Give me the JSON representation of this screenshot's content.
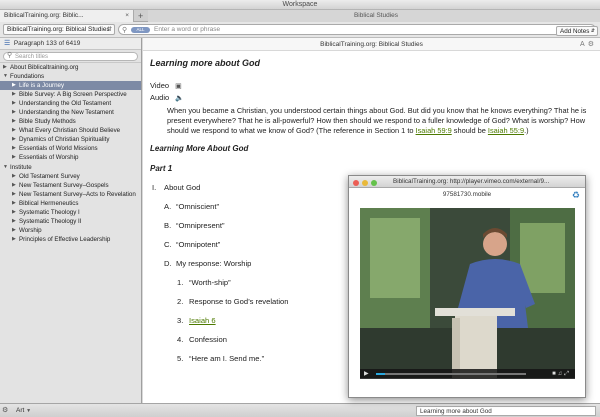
{
  "window": {
    "title": "Workspace"
  },
  "tabs": [
    {
      "label": "BiblicalTraining.org: Biblic...",
      "close": "×"
    },
    {
      "label": "+"
    },
    {
      "label": "Biblical Studies"
    }
  ],
  "toolbar": {
    "resource_select": "BiblicalTraining.org: Biblical Studies",
    "search_pill": "ALL",
    "search_placeholder": "Enter a word or phrase"
  },
  "sidebar": {
    "paragraph_status": "Paragraph 133 of 6419",
    "search_placeholder": "Search titles",
    "items": [
      {
        "label": "About Biblicaltraining.org",
        "level": 0,
        "expanded": false
      },
      {
        "label": "Foundations",
        "level": 0,
        "expanded": true
      },
      {
        "label": "Life is a Journey",
        "level": 1,
        "expanded": false,
        "selected": true
      },
      {
        "label": "Bible Survey: A Big Screen Perspective",
        "level": 1,
        "expanded": false
      },
      {
        "label": "Understanding the Old Testament",
        "level": 1,
        "expanded": false
      },
      {
        "label": "Understanding the New Testament",
        "level": 1,
        "expanded": false
      },
      {
        "label": "Bible Study Methods",
        "level": 1,
        "expanded": false
      },
      {
        "label": "What Every Christian Should Believe",
        "level": 1,
        "expanded": false
      },
      {
        "label": "Dynamics of Christian Spirituality",
        "level": 1,
        "expanded": false
      },
      {
        "label": "Essentials of World Missions",
        "level": 1,
        "expanded": false
      },
      {
        "label": "Essentials of Worship",
        "level": 1,
        "expanded": false
      },
      {
        "label": "Institute",
        "level": 0,
        "expanded": true
      },
      {
        "label": "Old Testament Survey",
        "level": 1,
        "expanded": false
      },
      {
        "label": "New Testament Survey–Gospels",
        "level": 1,
        "expanded": false
      },
      {
        "label": "New Testament Survey–Acts to Revelation",
        "level": 1,
        "expanded": false
      },
      {
        "label": "Biblical Hermeneutics",
        "level": 1,
        "expanded": false
      },
      {
        "label": "Systematic Theology I",
        "level": 1,
        "expanded": false
      },
      {
        "label": "Systematic Theology II",
        "level": 1,
        "expanded": false
      },
      {
        "label": "Worship",
        "level": 1,
        "expanded": false
      },
      {
        "label": "Principles of Effective Leadership",
        "level": 1,
        "expanded": false
      }
    ]
  },
  "reader": {
    "header_title": "BiblicalTraining.org: Biblical Studies",
    "add_notes": "Add Notes",
    "title": "Learning more about God",
    "media_video": "Video",
    "media_audio": "Audio",
    "para_before": "When you became a Christian, you understood certain things about God. But did you know that he knows everything? That he is present everywhere? That he is all-powerful? How then should we respond to a fuller knowledge of God? What is worship? How should we respond to what we know of God? (The reference in Section 1 to ",
    "para_link1": "Isaiah 59:9",
    "para_mid": " should be ",
    "para_link2": "Isaiah 55:9",
    "para_after": ".)",
    "subheading": "Learning More About God",
    "part": "Part 1",
    "outline": {
      "i_num": "I.",
      "i_label": "About God",
      "a_num": "A.",
      "a_label": "“Omniscient”",
      "b_num": "B.",
      "b_label": "“Omnipresent”",
      "c_num": "C.",
      "c_label": "“Omnipotent”",
      "d_num": "D.",
      "d_label": "My response: Worship",
      "d1_num": "1.",
      "d1_label": "“Worth-ship”",
      "d2_num": "2.",
      "d2_label": "Response to God’s revelation",
      "d3_num": "3.",
      "d3_label": "Isaiah 6",
      "d4_num": "4.",
      "d4_label": "Confession",
      "d5_num": "5.",
      "d5_label": "“Here am I. Send me.”"
    }
  },
  "video_window": {
    "title": "BiblicalTraining.org: http://player.vimeo.com/external/9...",
    "subtitle": "97581730.mobile",
    "progress": 0.06
  },
  "statusbar": {
    "art_label": "Art",
    "current_label": "Learning more about God"
  },
  "colors": {
    "link": "#4d7a00",
    "selection": "#7d8aa5",
    "accent": "#2d5ea8",
    "progress": "#2aa8e0"
  }
}
